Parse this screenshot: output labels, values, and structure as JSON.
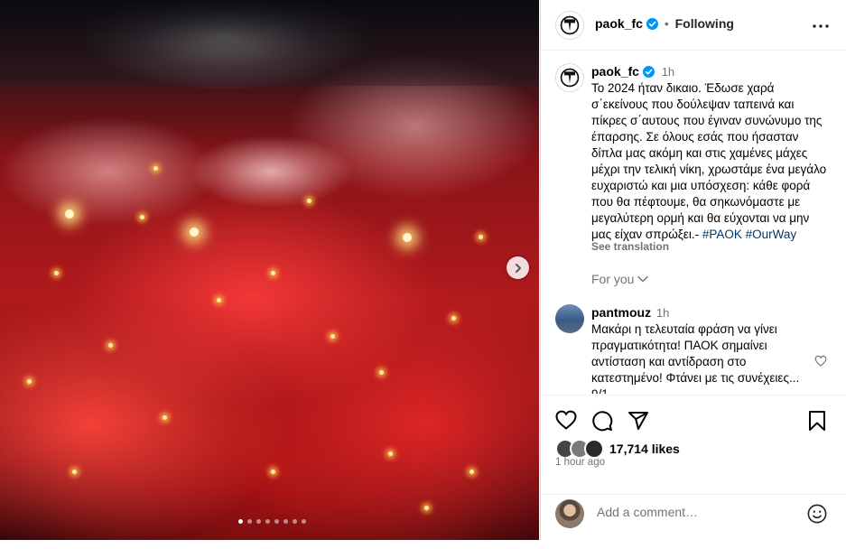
{
  "post": {
    "image_count": 8,
    "active_image_index": 0
  },
  "header": {
    "username": "paok_fc",
    "separator": "•",
    "follow_label": "Following"
  },
  "caption": {
    "username": "paok_fc",
    "time": "1h",
    "text": "Το 2024 ήταν δικαιο. Έδωσε χαρά σ΄εκείνους που δούλεψαν ταπεινά και πίκρες σ΄αυτους που έγιναν συνώνυμο της έπαρσης. Σε όλους εσάς που ήσασταν δίπλα μας ακόμη και στις χαμένες μάχες μέχρι την τελική νίκη, χρωστάμε ένα μεγάλο ευχαριστώ και μια υπόσχεση: κάθε φορά που θα πέφτουμε, θα σηκωνόμαστε με μεγαλύτερη ορμή και θα εύχονται να μην μας είχαν σπρώξει.-",
    "hashtags": [
      "#PAOK",
      "#OurWay"
    ],
    "see_translation": "See translation"
  },
  "for_you": "For you",
  "comment": {
    "username": "pantmouz",
    "time": "1h",
    "text": "Μακάρι η τελευταία φράση να γίνει πραγματικότητα! ΠΑΟΚ σημαίνει αντίσταση και αντίδραση στο κατεστημένο! Φτάνει με τις συνέχειες... 9/1"
  },
  "likes": {
    "count_label": "17,714 likes"
  },
  "time_ago": "1 hour ago",
  "add_comment": {
    "placeholder": "Add a comment…"
  },
  "colors": {
    "verified": "#0095f6",
    "hashtag": "#00376b",
    "secondary_text": "#737373"
  },
  "icons": [
    "heart-icon",
    "comment-icon",
    "share-icon",
    "bookmark-icon",
    "more-icon",
    "verified-icon",
    "chevron-right-icon",
    "chevron-down-icon",
    "emoji-icon"
  ]
}
